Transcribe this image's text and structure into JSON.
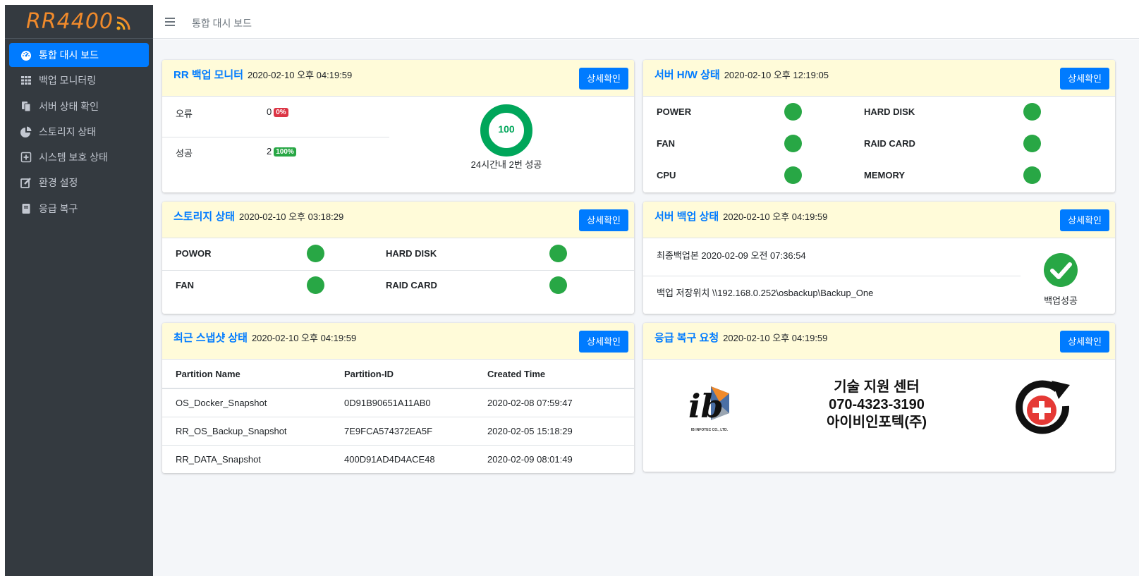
{
  "brand": {
    "name": "RR4400",
    "color": "#f08a2b"
  },
  "sidebar": {
    "items": [
      {
        "label": "통합 대시 보드",
        "icon": "dashboard-icon",
        "active": true
      },
      {
        "label": "백업 모니터링",
        "icon": "grid-icon"
      },
      {
        "label": "서버 상태 확인",
        "icon": "copy-icon"
      },
      {
        "label": "스토리지 상태",
        "icon": "pie-chart-icon"
      },
      {
        "label": "시스템 보호 상태",
        "icon": "plus-square-icon"
      },
      {
        "label": "환경 설정",
        "icon": "edit-icon"
      },
      {
        "label": "응급 복구",
        "icon": "book-icon"
      }
    ]
  },
  "header": {
    "breadcrumb": "통합 대시 보드"
  },
  "common": {
    "detail_button": "상세확인"
  },
  "backup_monitor": {
    "title": "RR 백업 모니터",
    "time": "2020-02-10 오후 04:19:59",
    "error_label": "오류",
    "error_count": "0",
    "error_pct": "0%",
    "success_label": "성공",
    "success_count": "2",
    "success_pct": "100%",
    "gauge_value": "100",
    "gauge_caption": "24시간내 2번 성공"
  },
  "server_hw": {
    "title": "서버 H/W 상태",
    "time": "2020-02-10 오후 12:19:05",
    "items": [
      "POWER",
      "HARD DISK",
      "FAN",
      "RAID CARD",
      "CPU",
      "MEMORY"
    ],
    "status_color": "#28a745"
  },
  "storage": {
    "title": "스토리지 상태",
    "time": "2020-02-10 오후 03:18:29",
    "items": [
      "POWOR",
      "HARD DISK",
      "FAN",
      "RAID CARD"
    ]
  },
  "server_backup": {
    "title": "서버 백업 상태",
    "time": "2020-02-10 오후 04:19:59",
    "last_backup": "최종백업본 2020-02-09 오전 07:36:54",
    "location": "백업 저장위치 \\\\192.168.0.252\\osbackup\\Backup_One",
    "status_text": "백업성공"
  },
  "snapshot": {
    "title": "최근 스냅샷 상태",
    "time": "2020-02-10 오후 04:19:59",
    "columns": [
      "Partition Name",
      "Partition-ID",
      "Created Time"
    ],
    "rows": [
      [
        "OS_Docker_Snapshot",
        "0D91B90651A11AB0",
        "2020-02-08 07:59:47"
      ],
      [
        "RR_OS_Backup_Snapshot",
        "7E9FCA574372EA5F",
        "2020-02-05 15:18:29"
      ],
      [
        "RR_DATA_Snapshot",
        "400D91AD4D4ACE48",
        "2020-02-09 08:01:49"
      ]
    ]
  },
  "recovery": {
    "title": "응급 복구 요청",
    "time": "2020-02-10 오후 04:19:59",
    "center_line1": "기술 지원 센터",
    "center_line2": "070-4323-3190",
    "center_line3": "아이비인포텍(주)",
    "logo_text": "ib",
    "logo_caption": "IB INFOTEC CO., LTD."
  }
}
